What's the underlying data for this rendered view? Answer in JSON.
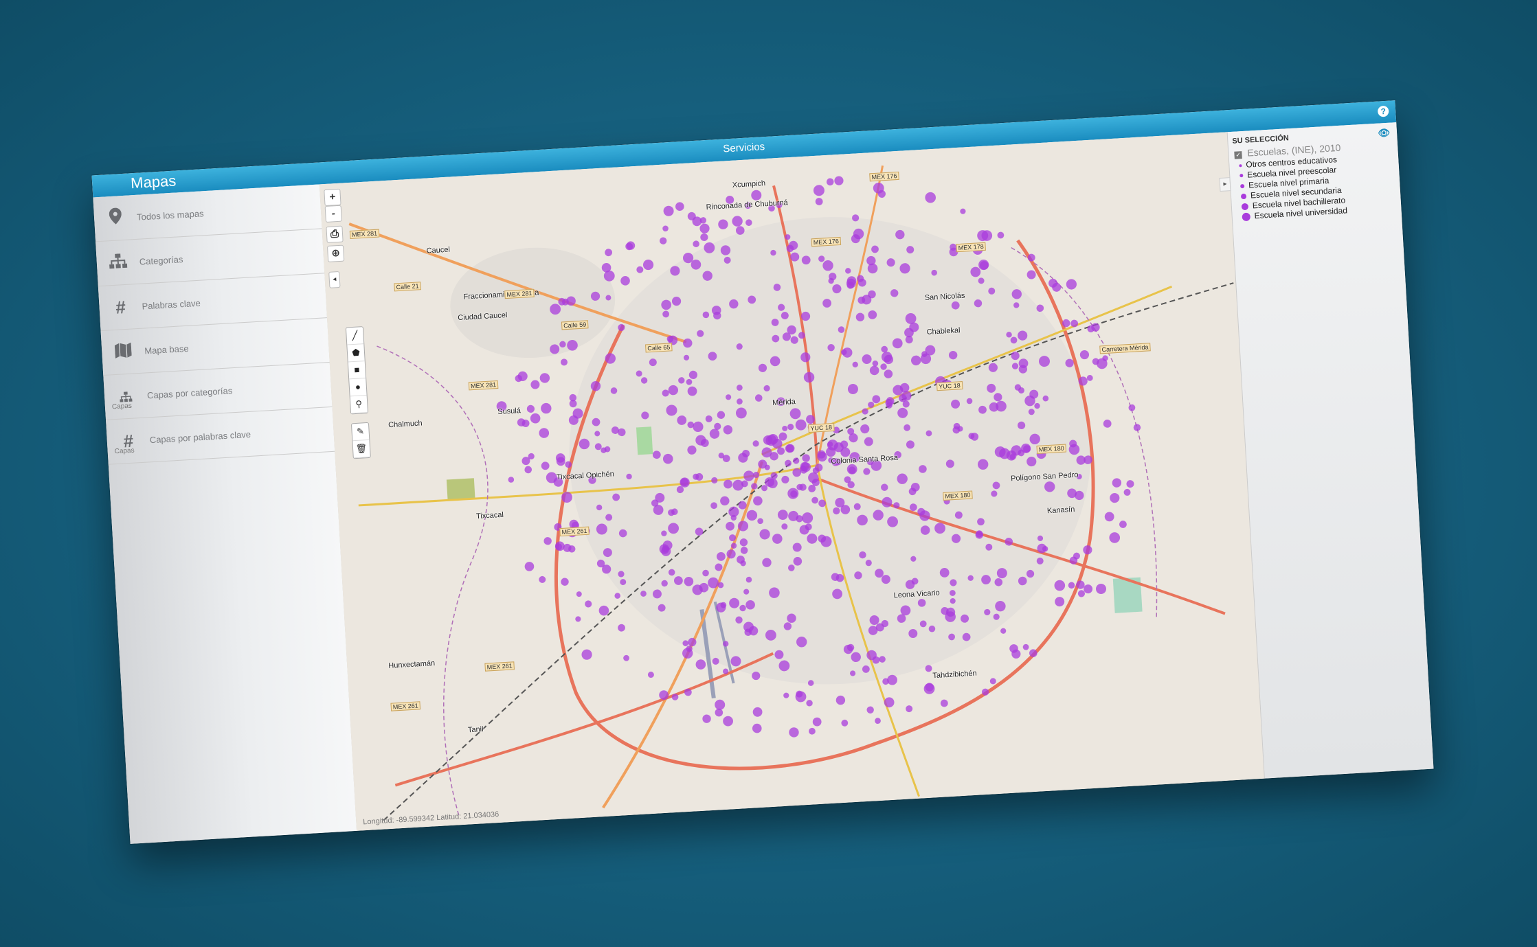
{
  "app": {
    "title": "Mapas",
    "center_title": "Servicios",
    "help_icon": "?"
  },
  "sidebar": {
    "items": [
      {
        "icon": "map-marker-icon",
        "label": "Todos los mapas",
        "sub": ""
      },
      {
        "icon": "sitemap-icon",
        "label": "Categorías",
        "sub": ""
      },
      {
        "icon": "hashtag-icon",
        "label": "Palabras clave",
        "sub": ""
      },
      {
        "icon": "folded-map-icon",
        "label": "Mapa base",
        "sub": ""
      },
      {
        "icon": "sitemap-icon",
        "label": "Capas por categorías",
        "sub": "Capas"
      },
      {
        "icon": "hashtag-icon",
        "label": "Capas por palabras clave",
        "sub": "Capas"
      }
    ]
  },
  "map": {
    "zoom_in": "+",
    "zoom_out": "-",
    "coords_text": "Longitud: -89.599342 Latitud: 21.034036",
    "point_color": "#a93cdc",
    "labels": [
      "Xcumpich",
      "Rinconada de Chuburná",
      "Caucel",
      "Fraccionamiento Perla",
      "Ciudad Caucel",
      "San Nicolás",
      "Chablekal",
      "Susulá",
      "Chalmuch",
      "Mérida",
      "Tixcacal Opichén",
      "Tixcacal",
      "Colonia Santa Rosa",
      "Polígono San Pedro",
      "Kanasín",
      "Leona Vicario",
      "Tanil",
      "Hunxectamán",
      "Tahdzibichén"
    ],
    "road_labels": [
      "MEX 281",
      "MEX 281",
      "MEX 281",
      "MEX 261",
      "MEX 261",
      "MEX 261",
      "MEX 176",
      "MEX 176",
      "MEX 178",
      "MEX 180",
      "MEX 180",
      "YUC 18",
      "YUC 18",
      "Calle 21",
      "Calle 59",
      "Calle 65",
      "Carretera Mérida"
    ]
  },
  "legend": {
    "header": "SU SELECCIÓN",
    "layer_title": "Escuelas, (INE), 2010",
    "items": [
      "Otros centros educativos",
      "Escuela nivel preescolar",
      "Escuela nivel primaria",
      "Escuela nivel secundaria",
      "Escuela nivel bachillerato",
      "Escuela nivel universidad"
    ]
  }
}
